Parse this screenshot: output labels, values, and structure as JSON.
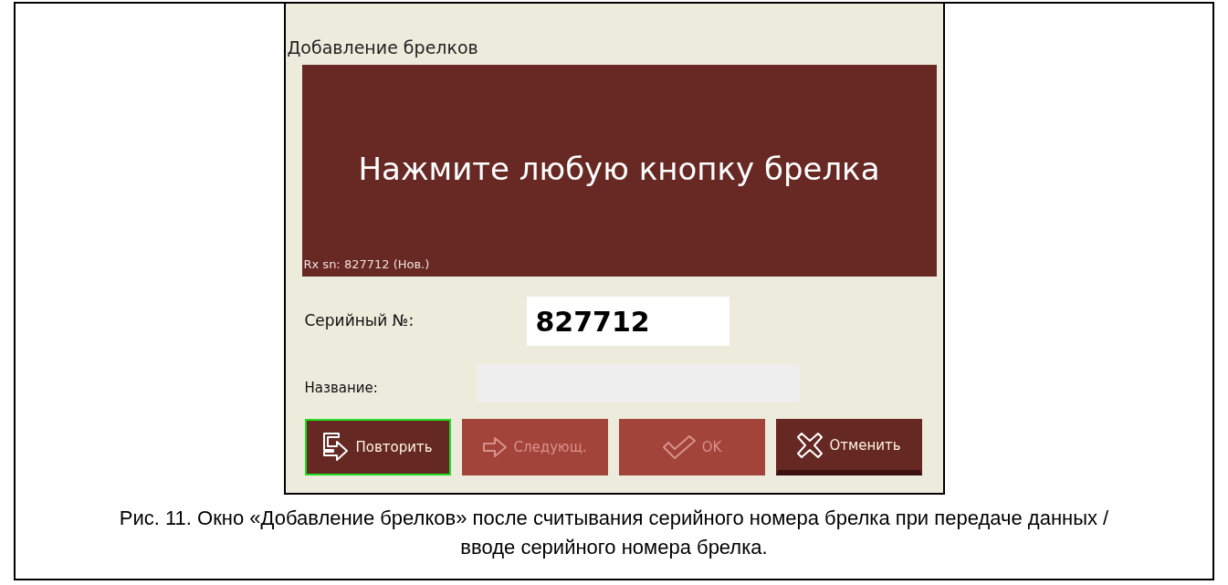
{
  "dialog": {
    "title": "Добавление брелков",
    "prompt": "Нажмите любую кнопку брелка",
    "status": "Rx sn: 827712 (Нов.)",
    "serial": {
      "label": "Серийный №:",
      "value": "827712"
    },
    "name": {
      "label": "Название:"
    },
    "buttons": [
      {
        "kind": "repeat",
        "label": "Повторить",
        "disabled": false,
        "focused": true
      },
      {
        "kind": "next",
        "label": "Следующ.",
        "disabled": true,
        "focused": false
      },
      {
        "kind": "ok",
        "label": "OK",
        "disabled": true,
        "focused": false
      },
      {
        "kind": "cancel",
        "label": "Отменить",
        "disabled": false,
        "focused": false
      }
    ]
  },
  "caption": "Рис. 11. Окно «Добавление брелков» после считывания серийного номера брелка при передаче данных / вводе серийного номера брелка."
}
